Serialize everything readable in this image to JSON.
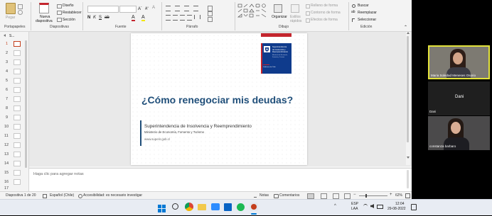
{
  "ribbon": {
    "portapapeles": {
      "pegar": "Pegar",
      "label": "Portapapeles"
    },
    "diapositivas": {
      "nueva_line1": "Nueva",
      "nueva_line2": "diapositiva",
      "diseno": "Diseño",
      "restablecer": "Restablecer",
      "seccion": "Sección",
      "label": "Diapositivas"
    },
    "fuente": {
      "label": "Fuente"
    },
    "parrafo": {
      "label": "Párrafo"
    },
    "dibujo": {
      "organizar": "Organizar",
      "estilos_line1": "Estilos",
      "estilos_line2": "rápidos",
      "relleno": "Relleno de forma",
      "contorno": "Contorno de forma",
      "efectos": "Efectos de forma",
      "label": "Dibujo"
    },
    "edicion": {
      "buscar": "Buscar",
      "reemplazar": "Reemplazar",
      "seleccionar": "Seleccionar",
      "label": "Edición"
    }
  },
  "thumbnails": {
    "header": "S...",
    "slides": [
      "1",
      "2",
      "3",
      "4",
      "5",
      "6",
      "7",
      "8",
      "9",
      "10",
      "11",
      "12",
      "13",
      "14",
      "15",
      "16",
      "17"
    ]
  },
  "slide": {
    "logo_line1": "Superintendencia",
    "logo_line2": "de Insolvencia y",
    "logo_line3": "Reemprendimiento",
    "logo_sub1": "Ministerio de Economía,",
    "logo_sub2": "Fomento y Turismo",
    "logo_gov": "Gobierno de Chile",
    "title": "¿Cómo renegociar mis deudas?",
    "org": "Superintendencia de Insolvencia y Reemprendimiento",
    "ministry": "Ministerio de Economía, Fomento y Turismo",
    "url": "www.superir.gob.cl"
  },
  "notes": {
    "placeholder": "Haga clic para agregar notas"
  },
  "status": {
    "slide": "Diapositiva 1 de 20",
    "language": "Español (Chile)",
    "accessibility": "Accesibilidad: es necesario investigar",
    "notas": "Notas",
    "comentarios": "Comentarios",
    "zoom": "62%"
  },
  "participants": [
    {
      "name": "Maria Soledad Meneses Osorio"
    },
    {
      "name": "Dani"
    },
    {
      "name": "constanza barbaro"
    }
  ],
  "taskbar": {
    "lang_line1": "ESP",
    "lang_line2": "LAA",
    "time": "12:04",
    "date": "29-08-2022"
  },
  "colors": {
    "accent_red": "#c4252d",
    "gov_blue": "#0f3b8c",
    "title_blue": "#1f4e79"
  }
}
